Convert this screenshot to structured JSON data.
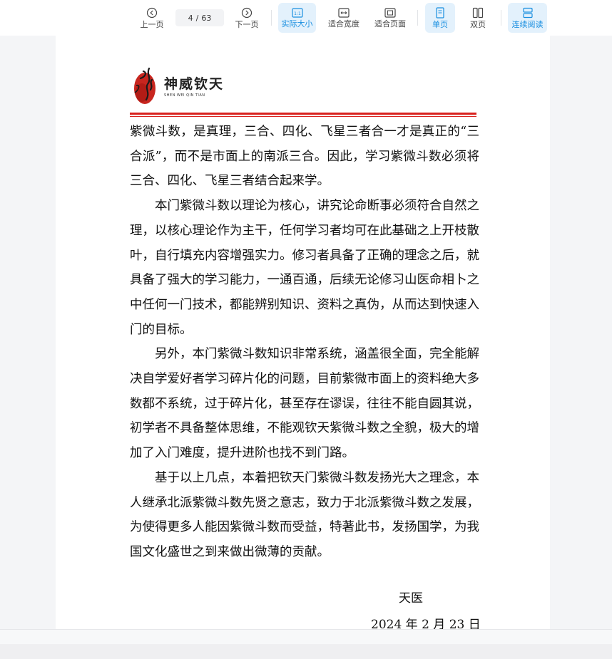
{
  "toolbar": {
    "prev_label": "上一页",
    "next_label": "下一页",
    "current_page": "4",
    "page_separator": "/",
    "total_pages": "63",
    "actual_size_label": "实际大小",
    "fit_width_label": "适合宽度",
    "fit_page_label": "适合页面",
    "single_page_label": "单页",
    "double_page_label": "双页",
    "continuous_label": "连续阅读",
    "accent_color": "#1a8fe0",
    "active_bg_color": "#e3f1fc"
  },
  "document": {
    "logo": {
      "name_cn": "神威钦天",
      "name_en": "SHEN WEI QIN TIAN",
      "icon": "calligraphy-seal-logo"
    },
    "rule_color": "#d9221e",
    "paragraphs": [
      "紫微斗数，是真理，三合、四化、飞星三者合一才是真正的“三合派”，而不是市面上的南派三合。因此，学习紫微斗数必须将三合、四化、飞星三者结合起来学。",
      "本门紫微斗数以理论为核心，讲究论命断事必须符合自然之理，以核心理论作为主干，任何学习者均可在此基础之上开枝散叶，自行填充内容增强实力。修习者具备了正确的理念之后，就具备了强大的学习能力，一通百通，后续无论修习山医命相卜之中任何一门技术，都能辨别知识、资料之真伪，从而达到快速入门的目标。",
      "另外，本门紫微斗数知识非常系统，涵盖很全面，完全能解决自学爱好者学习碎片化的问题，目前紫微市面上的资料绝大多数都不系统，过于碎片化，甚至存在谬误，往往不能自圆其说，初学者不具备整体思维，不能观钦天紫微斗数之全貌，极大的增加了入门难度，提升进阶也找不到门路。",
      "基于以上几点，本着把钦天门紫微斗数发扬光大之理念，本人继承北派紫微斗数先贤之意志，致力于北派紫微斗数之发展，为使得更多人能因紫微斗数而受益，特著此书，发扬国学，为我国文化盛世之到来做出微薄的贡献。"
    ],
    "signature": "天医",
    "date": "2024 年 2 月 23 日"
  }
}
